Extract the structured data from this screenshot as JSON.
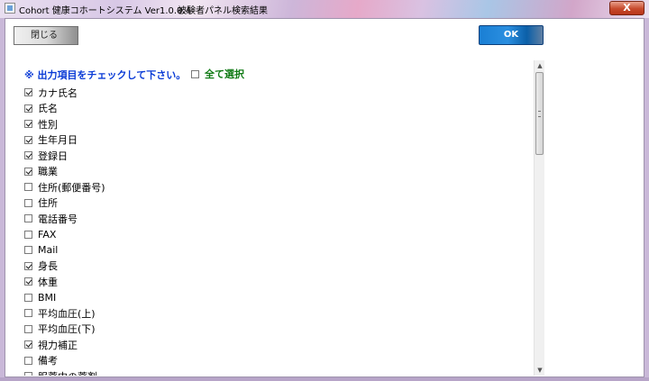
{
  "window": {
    "title": "Cohort 健康コホートシステム Ver1.0.0.4",
    "subtitle": "被験者パネル検索結果",
    "close_glyph": "X"
  },
  "toolbar": {
    "close_label": "閉じる",
    "ok_label": "OK"
  },
  "panel": {
    "instruction": "※ 出力項目をチェックして下さい。",
    "select_all_label": "全て選択",
    "select_all_checked": false,
    "items": [
      {
        "label": "カナ氏名",
        "checked": true
      },
      {
        "label": "氏名",
        "checked": true
      },
      {
        "label": "性別",
        "checked": true
      },
      {
        "label": "生年月日",
        "checked": true
      },
      {
        "label": "登録日",
        "checked": true
      },
      {
        "label": "職業",
        "checked": true
      },
      {
        "label": "住所(郵便番号)",
        "checked": false
      },
      {
        "label": "住所",
        "checked": false
      },
      {
        "label": "電話番号",
        "checked": false
      },
      {
        "label": "FAX",
        "checked": false
      },
      {
        "label": "Mail",
        "checked": false
      },
      {
        "label": "身長",
        "checked": true
      },
      {
        "label": "体重",
        "checked": true
      },
      {
        "label": "BMI",
        "checked": false
      },
      {
        "label": "平均血圧(上)",
        "checked": false
      },
      {
        "label": "平均血圧(下)",
        "checked": false
      },
      {
        "label": "視力補正",
        "checked": true
      },
      {
        "label": "備考",
        "checked": false
      },
      {
        "label": "服薬中の薬剤",
        "checked": false
      }
    ]
  },
  "icons": {
    "scroll_up": "▲",
    "scroll_down": "▼"
  }
}
